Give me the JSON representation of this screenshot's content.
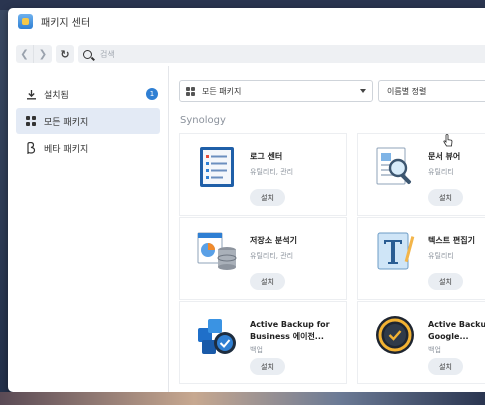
{
  "window": {
    "title": "패키지 센터"
  },
  "toolbar": {
    "search_placeholder": "검색"
  },
  "sidebar": {
    "items": [
      {
        "label": "설치됨",
        "badge": "1",
        "icon": "download-icon"
      },
      {
        "label": "모든 패키지",
        "icon": "grid-icon"
      },
      {
        "label": "베타 패키지",
        "icon": "beta-icon"
      }
    ]
  },
  "filters": {
    "category": "모든 패키지",
    "sort": "이름별 정렬"
  },
  "section": {
    "title": "Synology"
  },
  "packages": [
    {
      "name": "로그 센터",
      "category": "유틸리티, 관리",
      "button": "설치",
      "icon": "log-center-icon"
    },
    {
      "name": "문서 뷰어",
      "category": "유틸리티",
      "button": "설치",
      "icon": "document-viewer-icon"
    },
    {
      "name": "저장소 분석기",
      "category": "유틸리티, 관리",
      "button": "설치",
      "icon": "storage-analyzer-icon"
    },
    {
      "name": "텍스트 편집기",
      "category": "유틸리티",
      "button": "설치",
      "icon": "text-editor-icon"
    },
    {
      "name_line1": "Active Backup for",
      "name_line2": "Business 에이전...",
      "category": "백업",
      "button": "설치",
      "icon": "active-backup-business-icon"
    },
    {
      "name_line1": "Active Backup",
      "name_line2": "Google...",
      "category": "백업",
      "button": "설치",
      "icon": "active-backup-google-icon"
    }
  ],
  "colors": {
    "accent": "#2f7fd3",
    "active_bg": "#e3eaf5"
  }
}
